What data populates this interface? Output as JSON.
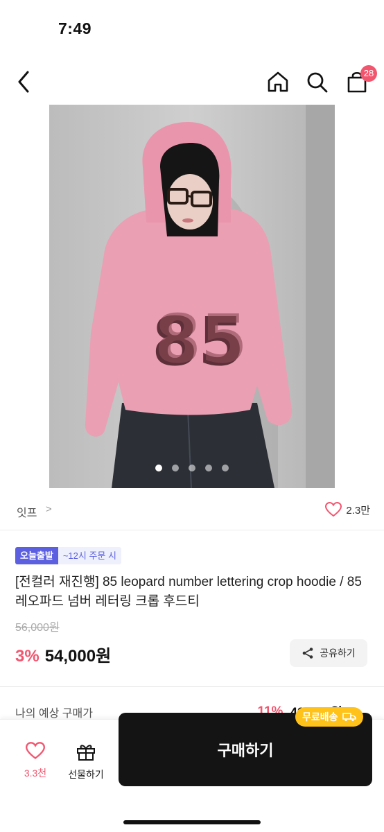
{
  "status_bar": {
    "time": "7:49"
  },
  "nav": {
    "cart_count": "28"
  },
  "image": {
    "dots": 5,
    "active_index": 0
  },
  "brand": {
    "name": "잇프",
    "chevron": ">",
    "like_count": "2.3만"
  },
  "badges": {
    "today": "오늘출발",
    "cutoff": "~12시 주문 시"
  },
  "product": {
    "title": "[전컬러 재진행] 85 leopard number lettering crop hoodie / 85 레오파드 넘버 레터링 크롭 후드티",
    "original_price": "56,000원",
    "discount": "3%",
    "price": "54,000원",
    "share_label": "공유하기"
  },
  "estimate": {
    "label": "나의 예상 구매가",
    "discount": "11%",
    "price": "49,430원"
  },
  "bottom_bar": {
    "wish_count": "3.3천",
    "gift_label": "선물하기",
    "buy_label": "구매하기",
    "free_shipping": "무료배송"
  },
  "colors": {
    "accent": "#f2566f",
    "badge": "#5b5fe0",
    "buy": "#141414",
    "free_ship": "#ffc21a"
  }
}
